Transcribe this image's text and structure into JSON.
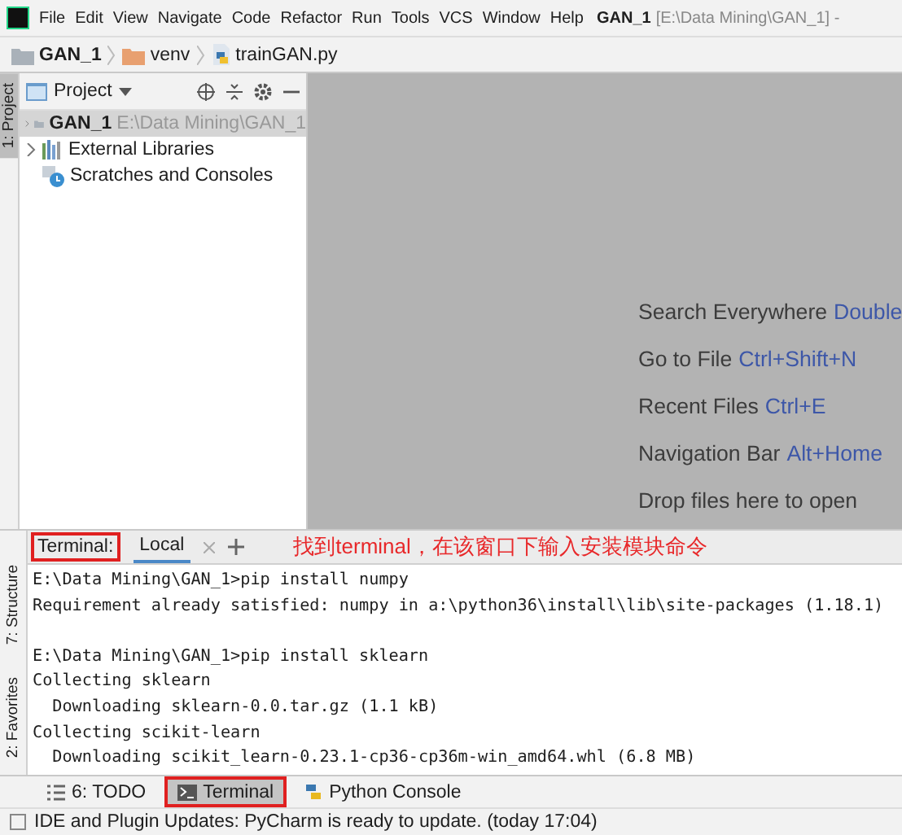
{
  "menu_bar": {
    "items": [
      "File",
      "Edit",
      "View",
      "Navigate",
      "Code",
      "Refactor",
      "Run",
      "Tools",
      "VCS",
      "Window",
      "Help"
    ],
    "title": "GAN_1",
    "title_path": "[E:\\Data Mining\\GAN_1] -"
  },
  "breadcrumb": [
    {
      "label": "GAN_1",
      "kind": "project"
    },
    {
      "label": "venv",
      "kind": "folder"
    },
    {
      "label": "trainGAN.py",
      "kind": "file"
    }
  ],
  "left_stripe": {
    "top": [
      {
        "label": "1: Project",
        "selected": true
      }
    ],
    "bottom": [
      {
        "label": "7: Structure",
        "selected": false
      },
      {
        "label": "2: Favorites",
        "selected": false
      }
    ]
  },
  "project_panel": {
    "title": "Project",
    "tree": [
      {
        "label": "GAN_1",
        "path": "E:\\Data Mining\\GAN_1",
        "kind": "project",
        "expanded": false,
        "selected": true
      },
      {
        "label": "External Libraries",
        "kind": "libraries",
        "expanded": false,
        "selected": false
      },
      {
        "label": "Scratches and Consoles",
        "kind": "scratches",
        "selected": false
      }
    ]
  },
  "editor_hints": [
    {
      "text": "Search Everywhere",
      "shortcut": "Double"
    },
    {
      "text": "Go to File",
      "shortcut": "Ctrl+Shift+N"
    },
    {
      "text": "Recent Files",
      "shortcut": "Ctrl+E"
    },
    {
      "text": "Navigation Bar",
      "shortcut": "Alt+Home"
    },
    {
      "text": "Drop files here to open"
    }
  ],
  "terminal": {
    "label": "Terminal:",
    "label_highlighted": true,
    "tabs": [
      {
        "label": "Local",
        "selected": true
      }
    ],
    "annotation": "找到terminal，在该窗口下输入安装模块命令",
    "lines": [
      {
        "text": "E:\\Data Mining\\GAN_1>pip install numpy",
        "gap_before": false
      },
      {
        "text": "Requirement already satisfied: numpy in a:\\python36\\install\\lib\\site-packages (1.18.1)",
        "gap_before": false
      },
      {
        "text": "E:\\Data Mining\\GAN_1>pip install sklearn",
        "gap_before": true
      },
      {
        "text": "Collecting sklearn",
        "gap_before": false
      },
      {
        "text": "  Downloading sklearn-0.0.tar.gz (1.1 kB)",
        "gap_before": false
      },
      {
        "text": "Collecting scikit-learn",
        "gap_before": false
      },
      {
        "text": "  Downloading scikit_learn-0.23.1-cp36-cp36m-win_amd64.whl (6.8 MB)",
        "gap_before": false
      }
    ]
  },
  "bottom_tabs": [
    {
      "label": "6: TODO",
      "kind": "todo",
      "selected": false,
      "highlighted": false
    },
    {
      "label": "Terminal",
      "kind": "terminal",
      "selected": true,
      "highlighted": true
    },
    {
      "label": "Python Console",
      "kind": "python",
      "selected": false,
      "highlighted": false
    }
  ],
  "status_bar": "IDE and Plugin Updates: PyCharm is ready to update. (today 17:04)"
}
